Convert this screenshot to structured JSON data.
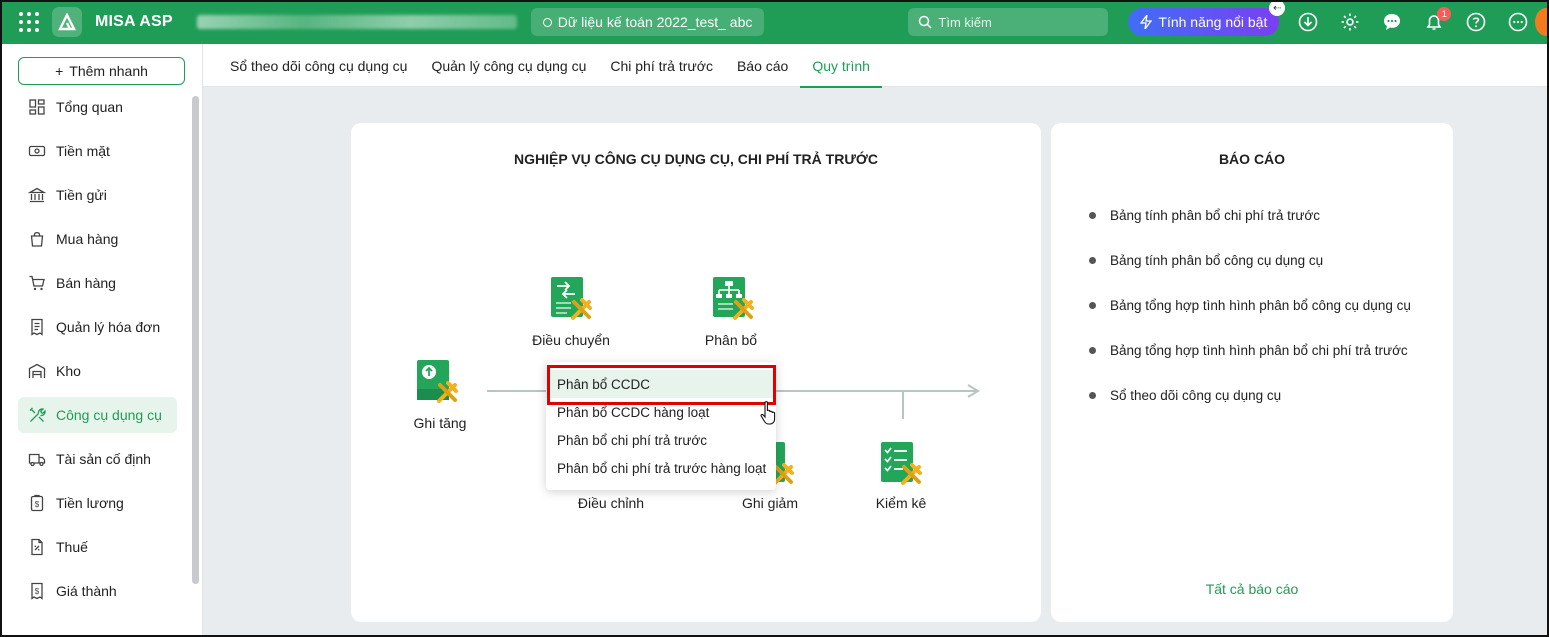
{
  "topbar": {
    "app_name": "MISA ASP",
    "database_label": "Dữ liệu kế toán 2022_test_ abc",
    "search_placeholder": "Tìm kiếm",
    "feature_label": "Tính năng nổi bật",
    "notification_count": "1",
    "brand_color": "#1f9d57"
  },
  "sidebar": {
    "quick_add": "Thêm nhanh",
    "items": [
      {
        "label": "Tổng quan",
        "icon": "dashboard-icon"
      },
      {
        "label": "Tiền mặt",
        "icon": "cash-icon"
      },
      {
        "label": "Tiền gửi",
        "icon": "bank-icon"
      },
      {
        "label": "Mua hàng",
        "icon": "shopping-bag-icon"
      },
      {
        "label": "Bán hàng",
        "icon": "cart-icon"
      },
      {
        "label": "Quản lý hóa đơn",
        "icon": "invoice-icon"
      },
      {
        "label": "Kho",
        "icon": "warehouse-icon"
      },
      {
        "label": "Công cụ dụng cụ",
        "icon": "tools-icon"
      },
      {
        "label": "Tài sản cố định",
        "icon": "truck-icon"
      },
      {
        "label": "Tiền lương",
        "icon": "salary-icon"
      },
      {
        "label": "Thuế",
        "icon": "tax-icon"
      },
      {
        "label": "Giá thành",
        "icon": "cost-icon"
      }
    ],
    "active_index": 7
  },
  "tabs": [
    {
      "label": "Sổ theo dõi công cụ dụng cụ"
    },
    {
      "label": "Quản lý công cụ dụng cụ"
    },
    {
      "label": "Chi phí trả trước"
    },
    {
      "label": "Báo cáo"
    },
    {
      "label": "Quy trình"
    }
  ],
  "active_tab": 4,
  "process": {
    "title": "NGHIỆP VỤ CÔNG CỤ DỤNG CỤ, CHI PHÍ TRẢ TRƯỚC",
    "steps": {
      "ghi_tang": "Ghi tăng",
      "dieu_chuyen": "Điều chuyển",
      "phan_bo": "Phân bổ",
      "dieu_chinh": "Điều chỉnh",
      "ghi_giam": "Ghi giảm",
      "kiem_ke": "Kiểm kê"
    }
  },
  "dropdown": {
    "items": [
      "Phân bổ CCDC",
      "Phân bổ CCDC hàng loạt",
      "Phân bổ chi phí trả trước",
      "Phân bổ chi phí trả trước hàng loạt"
    ],
    "highlighted_index": 0
  },
  "reports": {
    "title": "BÁO CÁO",
    "items": [
      "Bảng tính phân bổ chi phí trả trước",
      "Bảng tính phân bổ công cụ dụng cụ",
      "Bảng tổng hợp tình hình phân bổ công cụ dụng cụ",
      "Bảng tổng hợp tình hình phân bổ chi phí trả trước",
      "Sổ theo dõi công cụ dụng cụ"
    ],
    "all_link": "Tất cả báo cáo"
  }
}
